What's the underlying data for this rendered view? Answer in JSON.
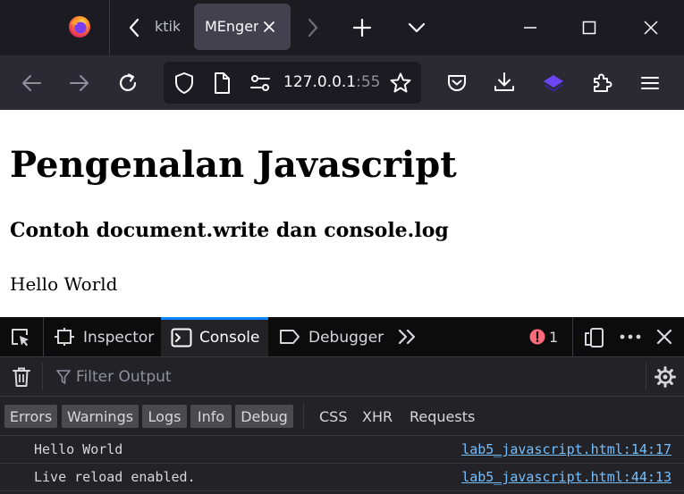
{
  "window": {
    "tabs": [
      {
        "label": "ktik",
        "active": false
      },
      {
        "label": "MEngenal",
        "active": true
      }
    ]
  },
  "navbar": {
    "url_host": "127.0.0.1",
    "url_port": ":55"
  },
  "page": {
    "h1": "Pengenalan Javascript",
    "h3": "Contoh document.write dan console.log",
    "p": "Hello World"
  },
  "devtools": {
    "tabs": [
      {
        "label": "Inspector",
        "active": false
      },
      {
        "label": "Console",
        "active": true
      },
      {
        "label": "Debugger",
        "active": false
      }
    ],
    "error_count": "1",
    "filter_placeholder": "Filter Output",
    "levels": [
      "Errors",
      "Warnings",
      "Logs",
      "Info",
      "Debug"
    ],
    "types": [
      "CSS",
      "XHR",
      "Requests"
    ],
    "logs": [
      {
        "message": "Hello World",
        "source": "lab5_javascript.html:14:17"
      },
      {
        "message": "Live reload enabled.",
        "source": "lab5_javascript.html:44:13"
      }
    ]
  },
  "colors": {
    "accent": "#0a84ff",
    "link": "#75bfff",
    "error": "#ff6b7a",
    "extension": "#6c46f5"
  }
}
